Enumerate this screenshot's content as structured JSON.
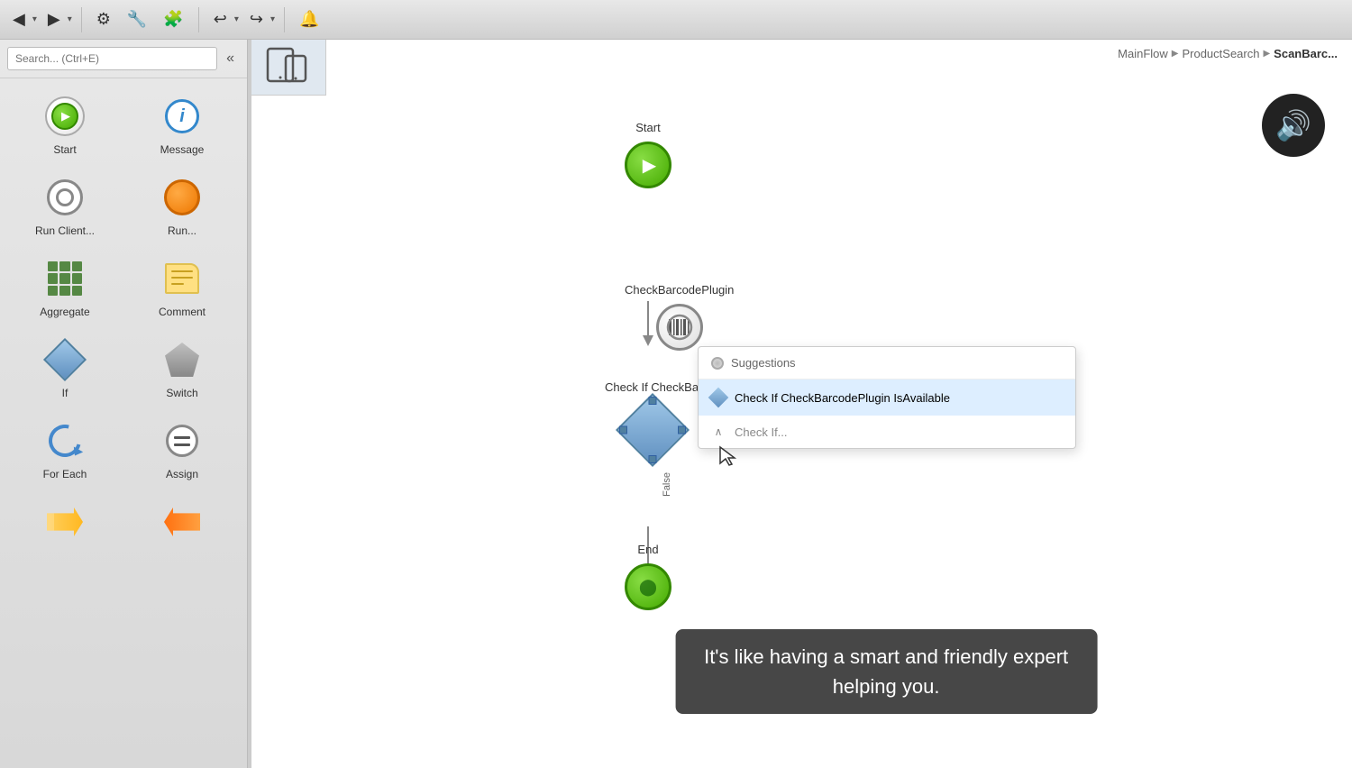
{
  "toolbar": {
    "back_label": "◀",
    "forward_label": "▶",
    "settings_label": "⚙",
    "wrench_label": "🔧",
    "puzzle_label": "🧩",
    "undo_label": "↩",
    "redo_label": "↪",
    "bell_label": "🔔"
  },
  "search": {
    "placeholder": "Search... (Ctrl+E)"
  },
  "tools": [
    {
      "id": "start",
      "label": "Start",
      "shape": "circle-green"
    },
    {
      "id": "message",
      "label": "Message",
      "shape": "info"
    },
    {
      "id": "run-client",
      "label": "Run Client...",
      "shape": "circle-outline"
    },
    {
      "id": "run",
      "label": "Run...",
      "shape": "circle-orange"
    },
    {
      "id": "aggregate",
      "label": "Aggregate",
      "shape": "grid"
    },
    {
      "id": "comment",
      "label": "Comment",
      "shape": "comment"
    },
    {
      "id": "if",
      "label": "If",
      "shape": "diamond"
    },
    {
      "id": "switch",
      "label": "Switch",
      "shape": "switch"
    },
    {
      "id": "for-each",
      "label": "For Each",
      "shape": "cycle"
    },
    {
      "id": "assign",
      "label": "Assign",
      "shape": "equals"
    },
    {
      "id": "arrow-right",
      "label": "",
      "shape": "arrow-right"
    },
    {
      "id": "arrow-left",
      "label": "",
      "shape": "arrow-left"
    }
  ],
  "breadcrumb": {
    "parts": [
      "MainFlow",
      "ProductSearch",
      "ScanBarc..."
    ],
    "separator": "▶"
  },
  "flow": {
    "start_label": "Start",
    "barcode_label": "CheckBarcodePlugin",
    "diamond_label": "Check If CheckBarc...",
    "false_label": "False",
    "end_label": "End"
  },
  "suggestion": {
    "header": "Suggestions",
    "item1": "Check If CheckBarcodePlugin IsAvailable",
    "item2": "Check If..."
  },
  "caption": {
    "line1": "It's like having a smart and friendly expert",
    "line2": "helping you."
  },
  "sound_btn": "🔊"
}
